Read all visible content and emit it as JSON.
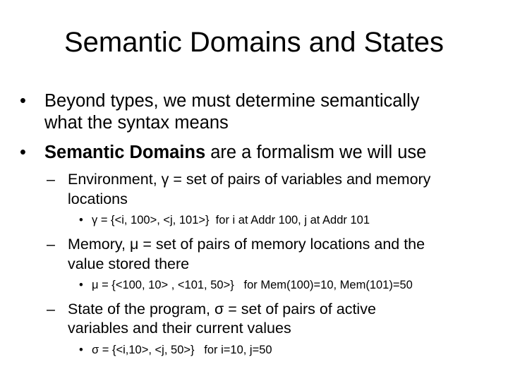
{
  "slide": {
    "title": "Semantic Domains and States",
    "bullets": [
      {
        "marker": "•",
        "lines": [
          "Beyond types, we must determine semantically",
          "what the syntax means"
        ]
      },
      {
        "marker": "•",
        "bold": "Semantic Domains",
        "rest": " are a formalism we will use"
      }
    ],
    "sub_bullets": [
      {
        "marker": "–",
        "lines": [
          "Environment, γ = set of pairs of variables and memory",
          "locations"
        ],
        "detail": {
          "marker": "•",
          "text": "γ = {<i, 100>, <j, 101>}  for i at Addr 100, j at Addr 101"
        }
      },
      {
        "marker": "–",
        "lines": [
          "Memory, μ = set of pairs of memory locations and the",
          "value stored there"
        ],
        "detail": {
          "marker": "•",
          "text": "μ = {<100, 10> , <101, 50>}   for Mem(100)=10, Mem(101)=50"
        }
      },
      {
        "marker": "–",
        "lines": [
          "State of the program, σ = set of pairs of active",
          "variables and their current values"
        ],
        "detail": {
          "marker": "•",
          "text": "σ = {<i,10>, <j, 50>}   for i=10, j=50"
        }
      }
    ]
  }
}
